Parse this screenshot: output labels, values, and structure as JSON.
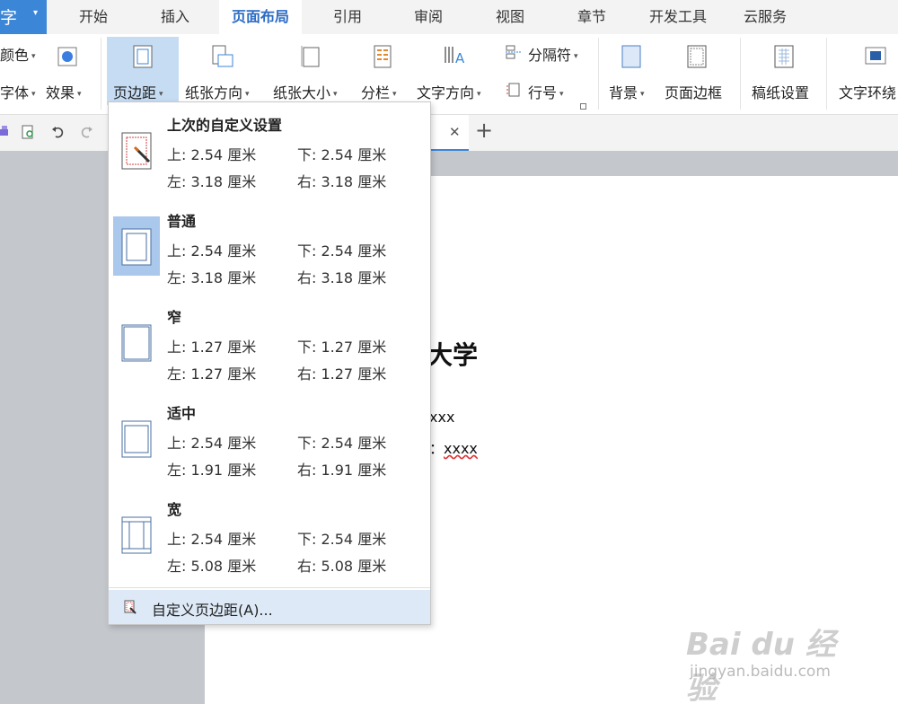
{
  "app": {
    "button_text": "字",
    "caret": "▾"
  },
  "tabs": [
    {
      "label": "开始"
    },
    {
      "label": "插入"
    },
    {
      "label": "页面布局"
    },
    {
      "label": "引用"
    },
    {
      "label": "审阅"
    },
    {
      "label": "视图"
    },
    {
      "label": "章节"
    },
    {
      "label": "开发工具"
    },
    {
      "label": "云服务"
    }
  ],
  "ribbon": {
    "color": "颜色",
    "font": "字体",
    "effect": "效果",
    "margins": "页边距",
    "orientation": "纸张方向",
    "size": "纸张大小",
    "columns": "分栏",
    "text_direction": "文字方向",
    "breaks": "分隔符",
    "line_numbers": "行号",
    "background": "背景",
    "page_border": "页面边框",
    "manuscript": "稿纸设置",
    "text_wrap": "文字环绕"
  },
  "margins_menu": {
    "items": [
      {
        "title": "上次的自定义设置",
        "top": "上: 2.54 厘米",
        "bottom": "下: 2.54 厘米",
        "left": "左: 3.18 厘米",
        "right": "右: 3.18 厘米"
      },
      {
        "title": "普通",
        "top": "上: 2.54 厘米",
        "bottom": "下: 2.54 厘米",
        "left": "左: 3.18 厘米",
        "right": "右: 3.18 厘米"
      },
      {
        "title": "窄",
        "top": "上: 1.27 厘米",
        "bottom": "下: 1.27 厘米",
        "left": "左: 1.27 厘米",
        "right": "右: 1.27 厘米"
      },
      {
        "title": "适中",
        "top": "上: 2.54 厘米",
        "bottom": "下: 2.54 厘米",
        "left": "左: 1.91 厘米",
        "right": "右: 1.91 厘米"
      },
      {
        "title": "宽",
        "top": "上: 2.54 厘米",
        "bottom": "下: 2.54 厘米",
        "left": "左: 5.08 厘米",
        "right": "右: 5.08 厘米"
      }
    ],
    "custom": "自定义页边距(A)..."
  },
  "document": {
    "heading": "大学",
    "line1": "xxx",
    "line2_prefix": "：",
    "line2_value": "xxxx"
  },
  "watermark": {
    "logo": "Bai du 经验",
    "url": "jingyan.baidu.com"
  },
  "colors": {
    "accent": "#3c86d8",
    "selected": "#c5dcf3",
    "menu_highlight": "#dde9f7"
  }
}
